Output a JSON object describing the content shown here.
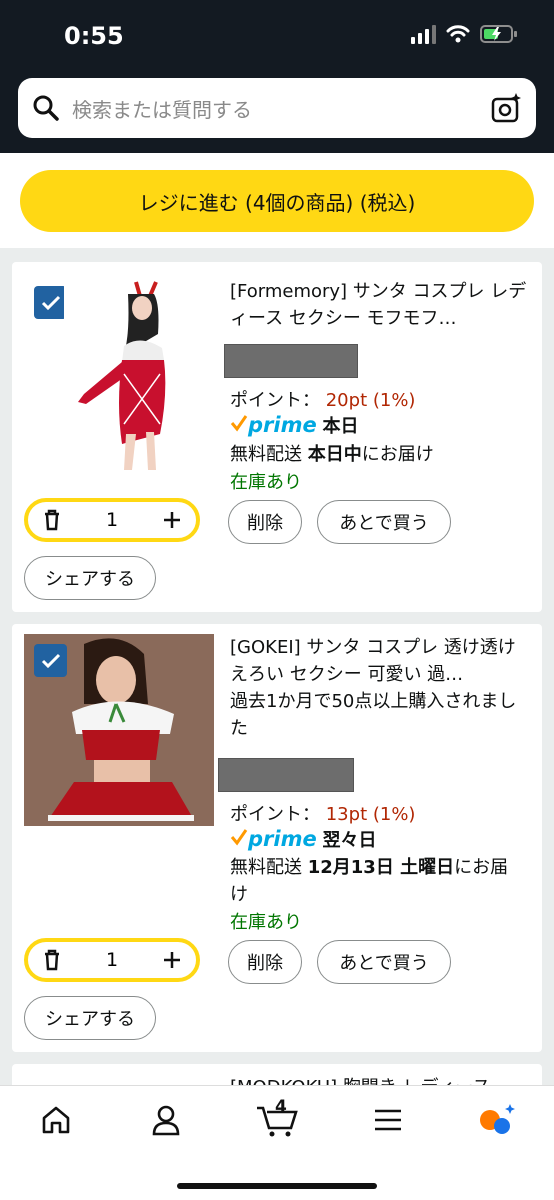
{
  "status": {
    "time": "0:55"
  },
  "search": {
    "placeholder": "検索または質問する"
  },
  "checkout": {
    "label": "レジに進む (4個の商品) (税込)"
  },
  "items": [
    {
      "title": "[Formemory] サンタ コスプレ レディース セクシー モフモフ…",
      "points_label": "ポイント：",
      "points_value": "20pt (1%)",
      "prime_word": "prime",
      "prime_day": "本日",
      "shipping_prefix": "無料配送 ",
      "shipping_bold": "本日中",
      "shipping_suffix": "にお届け",
      "stock": "在庫あり",
      "qty": "1",
      "delete_label": "削除",
      "later_label": "あとで買う",
      "share_label": "シェアする"
    },
    {
      "title": "[GOKEI] サンタ コスプレ 透け透け えろい セクシー 可愛い 過…",
      "purchase_note": "過去1か月で50点以上購入されました",
      "points_label": "ポイント：",
      "points_value": "13pt (1%)",
      "prime_word": "prime",
      "prime_day": "翌々日",
      "shipping_prefix": "無料配送 ",
      "shipping_bold": "12月13日 土曜日",
      "shipping_suffix": "にお届け",
      "stock": "在庫あり",
      "qty": "1",
      "delete_label": "削除",
      "later_label": "あとで買う",
      "share_label": "シェアする"
    },
    {
      "title": "[MODKOKU] 胸開き レディース"
    }
  ],
  "nav": {
    "cart_count": "4"
  },
  "colors": {
    "accent": "#ffd814",
    "checkbox": "#2162a1",
    "points": "#b12704",
    "stock": "#007600",
    "prime": "#00a8e1"
  }
}
